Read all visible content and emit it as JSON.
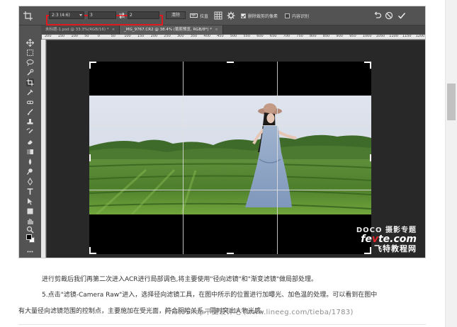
{
  "options_bar": {
    "ratio_value": "2:3 (4:6)",
    "width_value": "3",
    "height_value": "2",
    "clear_label": "清除",
    "straighten_label": "拉直",
    "delete_cropped_label": "删除裁剪的像素",
    "delete_cropped_checked": true,
    "content_aware_label": "内容识别",
    "content_aware_checked": false,
    "highlight_color": "#e0181f"
  },
  "tabs": [
    {
      "label": "未标题-1.psd @ 33.3%(RGB/16) *",
      "close": "×",
      "active": false
    },
    {
      "label": "_MG_9767.CR2 @ 38.4% (裁剪预览, RGB/8*) *",
      "close": "×",
      "active": true
    }
  ],
  "ruler_labels": [
    "200",
    "150",
    "100",
    "50",
    "0",
    "50",
    "100",
    "150",
    "200",
    "250",
    "300",
    "350",
    "400",
    "450",
    "500",
    "550",
    "600",
    "650",
    "700",
    "750",
    "800",
    "850",
    "900",
    "950",
    "1000",
    "1050",
    "1100",
    "1150",
    "1200"
  ],
  "watermark": {
    "line1": "DOCO 摄影专题",
    "line2_a": "fe",
    "line2_b": "v",
    "line2_c": "te.com",
    "line3": "飞特教程网"
  },
  "article": {
    "para1": "进行剪裁后我们再第二次进入ACR进行局部调色,将主要使用\"径向滤镜\"和\"渐变滤镜\"做局部处理。",
    "para2": "5.点击\"滤镜-Camera Raw\"进入，选择径向滤镜工具，在图中所示的位置进行加曝光、加色温的处理。可以看到在图中",
    "para3": "有大量径向滤镜范围的控制点，主要施加在受光面，符合阴暗关系，同时突出人物光感。",
    "overlay_url": "PhotoShop平面设计吧 (www.lineeg.com/tieba/1783)"
  },
  "icons": [
    "crop-tool-icon",
    "swap-icon",
    "grid-overlay-icon",
    "gear-icon",
    "undo-icon",
    "cancel-icon",
    "commit-icon",
    "move-tool-icon",
    "marquee-tool-icon",
    "lasso-tool-icon",
    "quick-select-icon",
    "crop-icon",
    "eyedropper-icon",
    "healing-brush-icon",
    "brush-icon",
    "clone-stamp-icon",
    "history-brush-icon",
    "eraser-icon",
    "gradient-icon",
    "blur-icon",
    "dodge-icon",
    "pen-icon",
    "type-icon",
    "path-select-icon",
    "shape-icon",
    "hand-icon",
    "zoom-icon",
    "more-tools-icon"
  ]
}
